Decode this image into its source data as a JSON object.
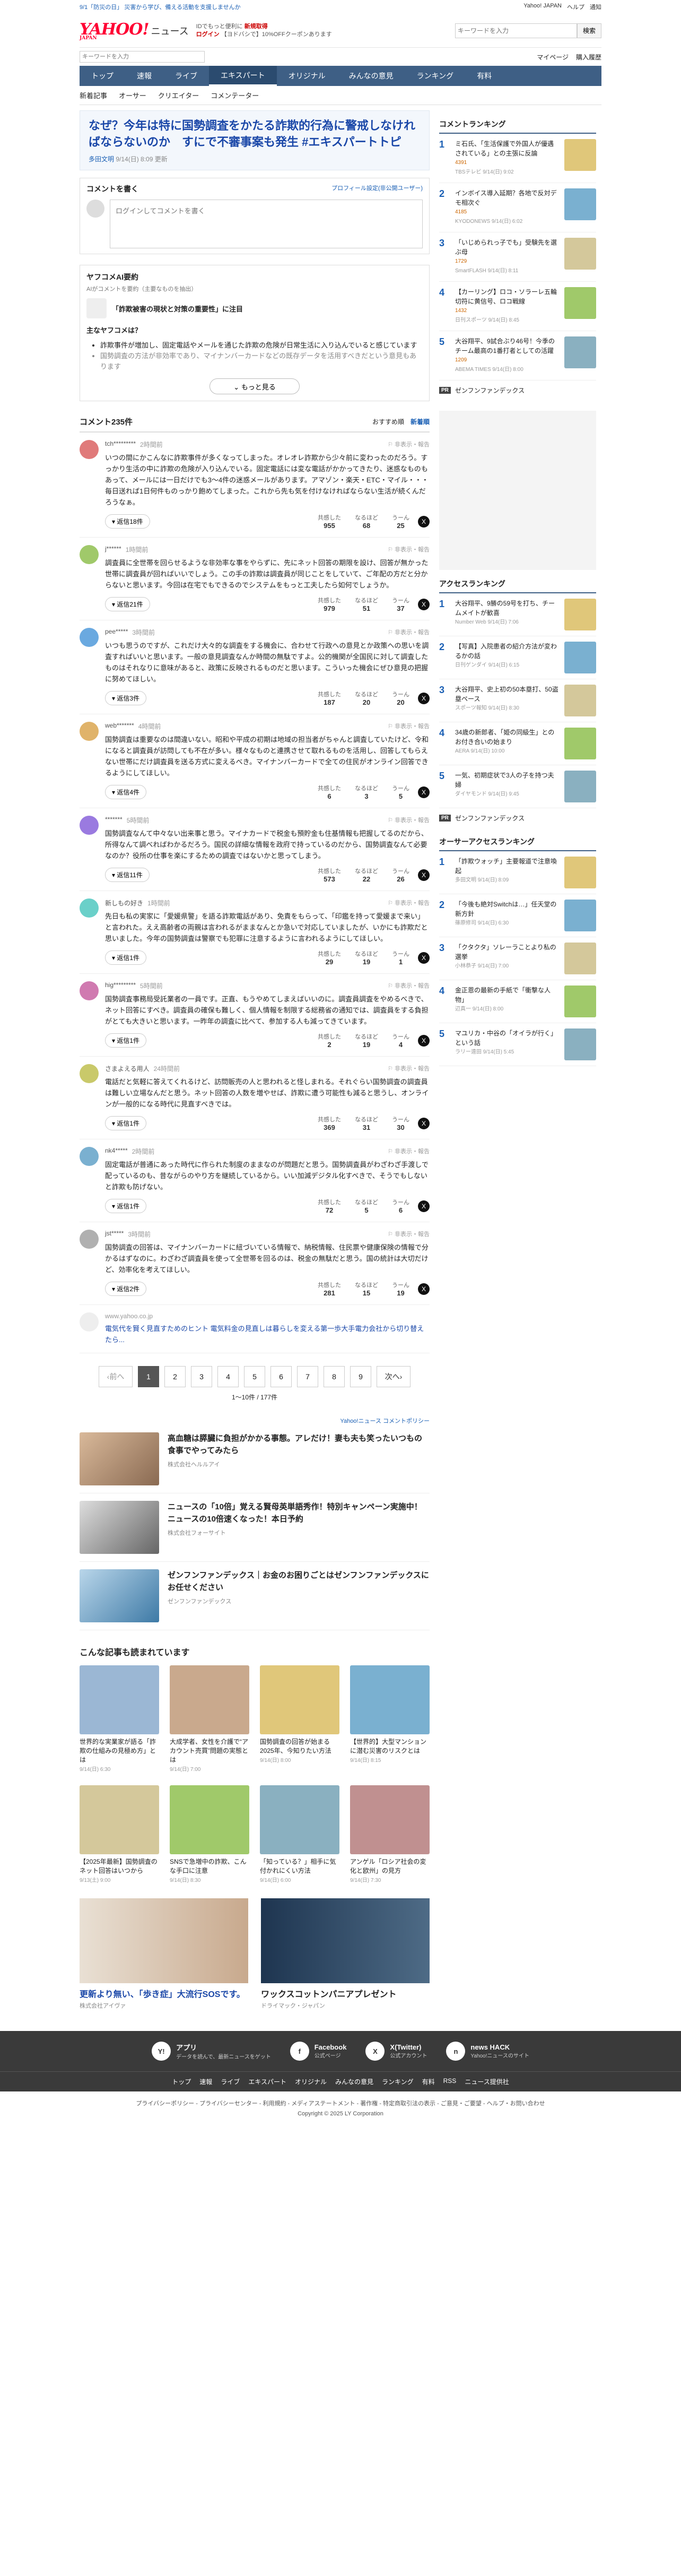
{
  "top": {
    "note": "9/1「防災の日」 災害から学び、備える活動を支援しませんか",
    "links": [
      "Yahoo! JAPAN",
      "ヘルプ"
    ],
    "notice_btn": "通知"
  },
  "brand": {
    "logo": "YAHOO!",
    "logo_sub": "JAPAN",
    "service": "ニュース",
    "promo1": "IDでもっと便利に",
    "promo1b": "新規取得",
    "promo2": "ログイン",
    "promo2b": "【ヨドバシで】10%OFFクーポンあります",
    "search_placeholder": "キーワードを入力",
    "search_btn": "検索"
  },
  "searchrow": {
    "placeholder": "キーワードを入力",
    "r1": "マイページ",
    "r2": "購入履歴"
  },
  "gnav": [
    "トップ",
    "速報",
    "ライブ",
    "エキスパート",
    "オリジナル",
    "みんなの意見",
    "ランキング",
    "有料"
  ],
  "gnav_active": 3,
  "subnav": [
    "新着記事",
    "オーサー",
    "クリエイター",
    "コメンテーター"
  ],
  "article": {
    "title": "なぜ？今年は特に国勢調査をかたる詐欺的行為に警戒しなければならないのか　すにで不審事案も発生 #エキスパートトピ",
    "author": "多田文明",
    "meta": "9/14(日) 8:09 更新"
  },
  "comment_box": {
    "title": "コメントを書く",
    "link": "プロフィール設定(非公開ユーザー)",
    "placeholder": "ログインしてコメントを書く"
  },
  "ai": {
    "title": "ヤフコメAI要約",
    "sub": "AIがコメントを要約（主要なものを抽出）",
    "topic": "「詐欺被害の現状と対策の重要性」に注目",
    "label": "主なヤフコメは？",
    "points": [
      "詐欺事件が増加し、固定電話やメールを通じた詐欺の危険が日常生活に入り込んでいると感じています",
      "国勢調査の方法が非効率であり、マイナンバーカードなどの既存データを活用すべきだという意見もあります"
    ],
    "more": "もっと見る"
  },
  "comments_head": {
    "title": "コメント235件",
    "sort1": "おすすめ順",
    "sort2": "新着順"
  },
  "comments": [
    {
      "user": "tch*********",
      "time": "2時間前",
      "text": "いつの間にかこんなに詐欺事件が多くなってしまった。オレオレ詐欺から少々前に変わったのだろう。すっかり生活の中に詐欺の危険が入り込んでいる。固定電話には変な電話がかかってきたり、迷惑なものもあって、メールには一日だけでも3～4件の迷惑メールがあります。アマゾン・楽天・ETC・マイル・・・毎日送れば1日何件ものっかり飽めてしまった。これから先も気を付けなければならない生活が続くんだろうなぁ。",
      "reply": "返信18件",
      "r1": "955",
      "r2": "68",
      "r3": "25"
    },
    {
      "user": "j******",
      "time": "1時間前",
      "text": "調査員に全世帯を回らせるような非効率な事をやらずに、先にネット回答の期限を設け、回答が無かった世帯に調査員が回ればいいでしょう。この手の詐欺は調査員が同じことをしていて、ご年配の方だと分からないと思います。今回は在宅でもできるのでシステムをもっと工夫したら如何でしょうか。",
      "reply": "返信21件",
      "r1": "979",
      "r2": "51",
      "r3": "37"
    },
    {
      "user": "pee*****",
      "time": "3時間前",
      "text": "いつも思うのですが、これだけ大々的な調査をする機会に、合わせて行政への意見とか政策への思いを調査すればいいと思います。一般の意見調査なんか時間の無駄ですよ。公的機関が全国民に対して調査したものはそれなりに意味があると、政策に反映されるものだと思います。こういった機会にぜひ意見の把握に努めてほしい。",
      "reply": "返信3件",
      "r1": "187",
      "r2": "20",
      "r3": "20"
    },
    {
      "user": "web*******",
      "time": "4時間前",
      "text": "国勢調査は重要なのは間違いない。昭和や平成の初期は地域の担当者がちゃんと調査していたけど、令和になると調査員が訪問しても不在が多い。様々なものと連携させて取れるものを活用し、回答してもらえない世帯にだけ調査員を送る方式に変えるべき。マイナンバーカードで全ての住民がオンライン回答できるようにしてほしい。",
      "reply": "返信4件",
      "r1": "6",
      "r2": "3",
      "r3": "5"
    },
    {
      "user": "*******",
      "time": "5時間前",
      "text": "国勢調査なんて中々ない出来事と思う。マイナカードで税金も預貯金も住基情報も把握してるのだから、所得なんて調べればわかるだろう。国民の詳細な情報を政府で持っているのだから、国勢調査なんて必要なのか？役所の仕事を楽にするための調査ではないかと思ってしまう。",
      "reply": "返信11件",
      "r1": "573",
      "r2": "22",
      "r3": "26"
    },
    {
      "user": "新しもの好き",
      "time": "1時間前",
      "text": "先日も私の実家に「愛媛県警」を語る詐欺電話があり、免責をもらって、「印鑑を持って愛媛まで来い」と言われた。ええ高齢者の両親は言われるがままなんとか急いで対応していましたが、いかにも詐欺だと思いました。今年の国勢調査は警察でも犯罪に注意するように言われるようにしてほしい。",
      "reply": "返信1件",
      "r1": "29",
      "r2": "19",
      "r3": "1"
    },
    {
      "user": "hig*********",
      "time": "5時間前",
      "text": "国勢調査事務局受託業者の一員です。正直、もうやめてしまえばいいのに。調査員調査をやめるべきで、ネット回答にすべき。調査員の確保も難しく、個人情報を制限する総務省の通知では、調査員をする負担がとても大きいと思います。一昨年の調査に比べて、参加する人も減ってきています。",
      "reply": "返信1件",
      "r1": "2",
      "r2": "19",
      "r3": "4"
    },
    {
      "user": "さまよえる用人",
      "time": "24時間前",
      "text": "電話だと気軽に答えてくれるけど、訪問販売の人と思われると怪しまれる。それぐらい国勢調査の調査員は難しい立場なんだと思う。ネット回答の人数を増やせば、詐欺に遭う可能性も減ると思うし、オンラインが一般的になる時代に見直すべきでは。",
      "reply": "返信1件",
      "r1": "369",
      "r2": "31",
      "r3": "30"
    },
    {
      "user": "nk4*****",
      "time": "2時間前",
      "text": "固定電話が普通にあった時代に作られた制度のままなのが問題だと思う。国勢調査員がわざわざ手渡しで配っているのも、昔ながらのやり方を継続しているから。いい加減デジタル化すべきで、そうでもしないと詐欺も防げない。",
      "reply": "返信1件",
      "r1": "72",
      "r2": "5",
      "r3": "6"
    },
    {
      "user": "jst*****",
      "time": "3時間前",
      "text": "国勢調査の回答は、マイナンバーカードに紐づいている情報で、納税情報、住民票や健康保険の情報で分かるはずなのに。わざわざ調査員を使って全世帯を回るのは、税金の無駄だと思う。国の統計は大切だけど、効率化を考えてほしい。",
      "reply": "返信2件",
      "r1": "281",
      "r2": "15",
      "r3": "19"
    }
  ],
  "inline_ad": {
    "source": "www.yahoo.co.jp",
    "text": "電気代を賢く見直すためのヒント 電気料金の見直しは暮らしを変える第一歩大手電力会社から切り替えたら..."
  },
  "pager": {
    "prev": "前へ",
    "next": "次へ",
    "pages": [
      "1",
      "2",
      "3",
      "4",
      "5",
      "6",
      "7",
      "8",
      "9"
    ],
    "count": "1〜10件 / 177件"
  },
  "ads": {
    "label": "Yahoo!ニュース コメントポリシー",
    "items": [
      {
        "title": "高血糖は膵臓に負担がかかる事態。アレだけ！妻も夫も笑ったいつもの食事でやってみたら",
        "src": "株式会社ヘルルアイ"
      },
      {
        "title": "ニュースの「10倍」覚える賢母英単語秀作！特別キャンペーン実施中！ニュースの10倍速くなった！本日予約",
        "src": "株式会社フォーサイト"
      },
      {
        "title": "ゼンフンファンデックス｜お金のお困りごとはゼンフンファンデックスにお任せください",
        "src": "ゼンフンファンデックス"
      }
    ]
  },
  "recs": {
    "title": "こんな記事も読まれています",
    "items": [
      {
        "title": "世界的な実業家が語る「詐欺の仕組みの見極め方」とは",
        "src": "9/14(日) 6:30"
      },
      {
        "title": "大成学者、女性を介護で“アカウント売買”問題の実態とは",
        "src": "9/14(日) 7:00"
      },
      {
        "title": "国勢調査の回答が始まる2025年、今知りたい方法",
        "src": "9/14(日) 8:00"
      },
      {
        "title": "【世界的】大型マンションに潜む災害のリスクとは",
        "src": "9/14(日) 8:15"
      },
      {
        "title": "【2025年最新】国勢調査のネット回答はいつから",
        "src": "9/13(土) 9:00"
      },
      {
        "title": "SNSで急増中の詐欺、こんな手口に注意",
        "src": "9/14(日) 8:30"
      },
      {
        "title": "「知っている？」相手に気付かれにくい方法",
        "src": "9/14(日) 6:00"
      },
      {
        "title": "アンゲル「ロシア社会の変化と欧州」の見方",
        "src": "9/14(日) 7:30"
      }
    ]
  },
  "banners": [
    {
      "title": "更新より無い、「歩き症」大流行SOSです。",
      "src": "株式会社アイヴァ"
    },
    {
      "title": "ワックスコットンパニアプレゼント",
      "src": "ドライマック・ジャパン"
    }
  ],
  "side": {
    "ranking_title": "コメントランキング",
    "ranking": [
      {
        "n": "1",
        "title": "ミ石氏、「生活保護で外国人が優遇されている」との主張に反論",
        "src": "TBSテレビ 9/14(日) 9:02",
        "cnt": "4391"
      },
      {
        "n": "2",
        "title": "インボイス導入延期？各地で反対デモ相次ぐ",
        "src": "KYODONEWS 9/14(日) 6:02",
        "cnt": "4185"
      },
      {
        "n": "3",
        "title": "「いじめられっ子でも」受験先を選ぶ母",
        "src": "SmartFLASH 9/14(日) 8:11",
        "cnt": "1729"
      },
      {
        "n": "4",
        "title": "【カーリング】ロコ・ソラーレ五輪切符に黄信号、ロコ戦線",
        "src": "日刊スポーツ 9/14(日) 8:45",
        "cnt": "1432"
      },
      {
        "n": "5",
        "title": "大谷翔平、9試合ぶり46号！今季のチーム最高の1番打者としての活躍",
        "src": "ABEMA TIMES 9/14(日) 8:00",
        "cnt": "1209"
      }
    ],
    "pr": "ゼンフンファンデックス",
    "access_title": "アクセスランキング",
    "access": [
      {
        "n": "1",
        "title": "大谷翔平、9勝の59号を打ち、チームメイトが歓喜",
        "src": "Number Web 9/14(日) 7:06"
      },
      {
        "n": "2",
        "title": "【写真】入院患者の紹介方法が変わるかの話",
        "src": "日刊ゲンダイ 9/14(日) 6:15"
      },
      {
        "n": "3",
        "title": "大谷翔平、史上初の50本塁打、50盗塁ペース",
        "src": "スポーツ報知 9/14(日) 8:30"
      },
      {
        "n": "4",
        "title": "34歳の新郎者、「姫の同級生」とのお付き合いの始まり",
        "src": "AERA 9/14(日) 10:00"
      },
      {
        "n": "5",
        "title": "一気、初期症状で3人の子を持つ夫婦",
        "src": "ダイヤモンド 9/14(日) 9:45"
      }
    ],
    "pr2": "ゼンフンファンデックス",
    "author_title": "オーサーアクセスランキング",
    "author": [
      {
        "n": "1",
        "title": "「詐欺ウォッチ」主要報道で注意喚起",
        "src": "多田文明 9/14(日) 8:09"
      },
      {
        "n": "2",
        "title": "「今後も絶対Switchは…」任天堂の新方針",
        "src": "篠原修司 9/14(日) 6:30"
      },
      {
        "n": "3",
        "title": "「クタクタ」ソレーラことより私の選挙",
        "src": "小林恭子 9/14(日) 7:00"
      },
      {
        "n": "4",
        "title": "金正恩の最新の手紙で「衝撃な人物」",
        "src": "辺真一 9/14(日) 8:00"
      },
      {
        "n": "5",
        "title": "マユリカ・中谷の「オイラが行く」という話",
        "src": "ラリー遠田 9/14(日) 5:45"
      }
    ]
  },
  "footer": {
    "apps": [
      {
        "label": "アプリ",
        "sub": "データを読んで、最新ニュースをゲット",
        "icon": "Y!"
      },
      {
        "label": "Facebook",
        "sub": "公式ページ",
        "icon": "f"
      },
      {
        "label": "X(Twitter)",
        "sub": "公式アカウント",
        "icon": "X"
      },
      {
        "label": "news HACK",
        "sub": "Yahoo!ニュースのサイト",
        "icon": "n"
      }
    ],
    "nav": [
      "トップ",
      "速報",
      "ライブ",
      "エキスパート",
      "オリジナル",
      "みんなの意見",
      "ランキング",
      "有料",
      "RSS",
      "ニュース提供社"
    ],
    "legal": "プライバシーポリシー - プライバシーセンター - 利用規約 - メディアステートメント - 著作権 - 特定商取引法の表示 - ご意見・ご要望 - ヘルプ・お問い合わせ",
    "copyright": "Copyright © 2025 LY Corporation"
  },
  "colors": {
    "accent": "#3e5f85",
    "link": "#1a5fb4",
    "brand": "#ff0033"
  }
}
